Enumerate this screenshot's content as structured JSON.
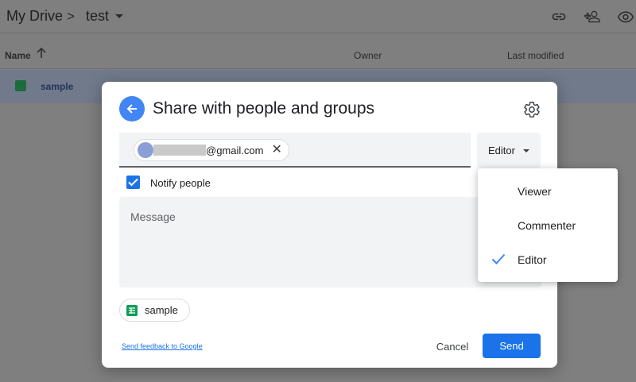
{
  "breadcrumb": {
    "root": "My Drive",
    "separator": ">",
    "folder": "test"
  },
  "columns": {
    "name": "Name",
    "owner": "Owner",
    "last_modified": "Last modified"
  },
  "file_row": {
    "name": "sample"
  },
  "dialog": {
    "title": "Share with people and groups",
    "recipient_email_suffix": "@gmail.com",
    "chip_remove": "✕",
    "role_button": "Editor",
    "notify_label": "Notify people",
    "notify_checked": true,
    "message_placeholder": "Message",
    "file_chip": "sample",
    "feedback_link": "Send feedback to Google",
    "cancel": "Cancel",
    "send": "Send"
  },
  "role_menu": {
    "items": [
      {
        "label": "Viewer",
        "selected": false
      },
      {
        "label": "Commenter",
        "selected": false
      },
      {
        "label": "Editor",
        "selected": true
      }
    ]
  },
  "colors": {
    "accent": "#1a73e8",
    "back_button": "#4285f4",
    "sheets_green": "#0f9d58"
  }
}
